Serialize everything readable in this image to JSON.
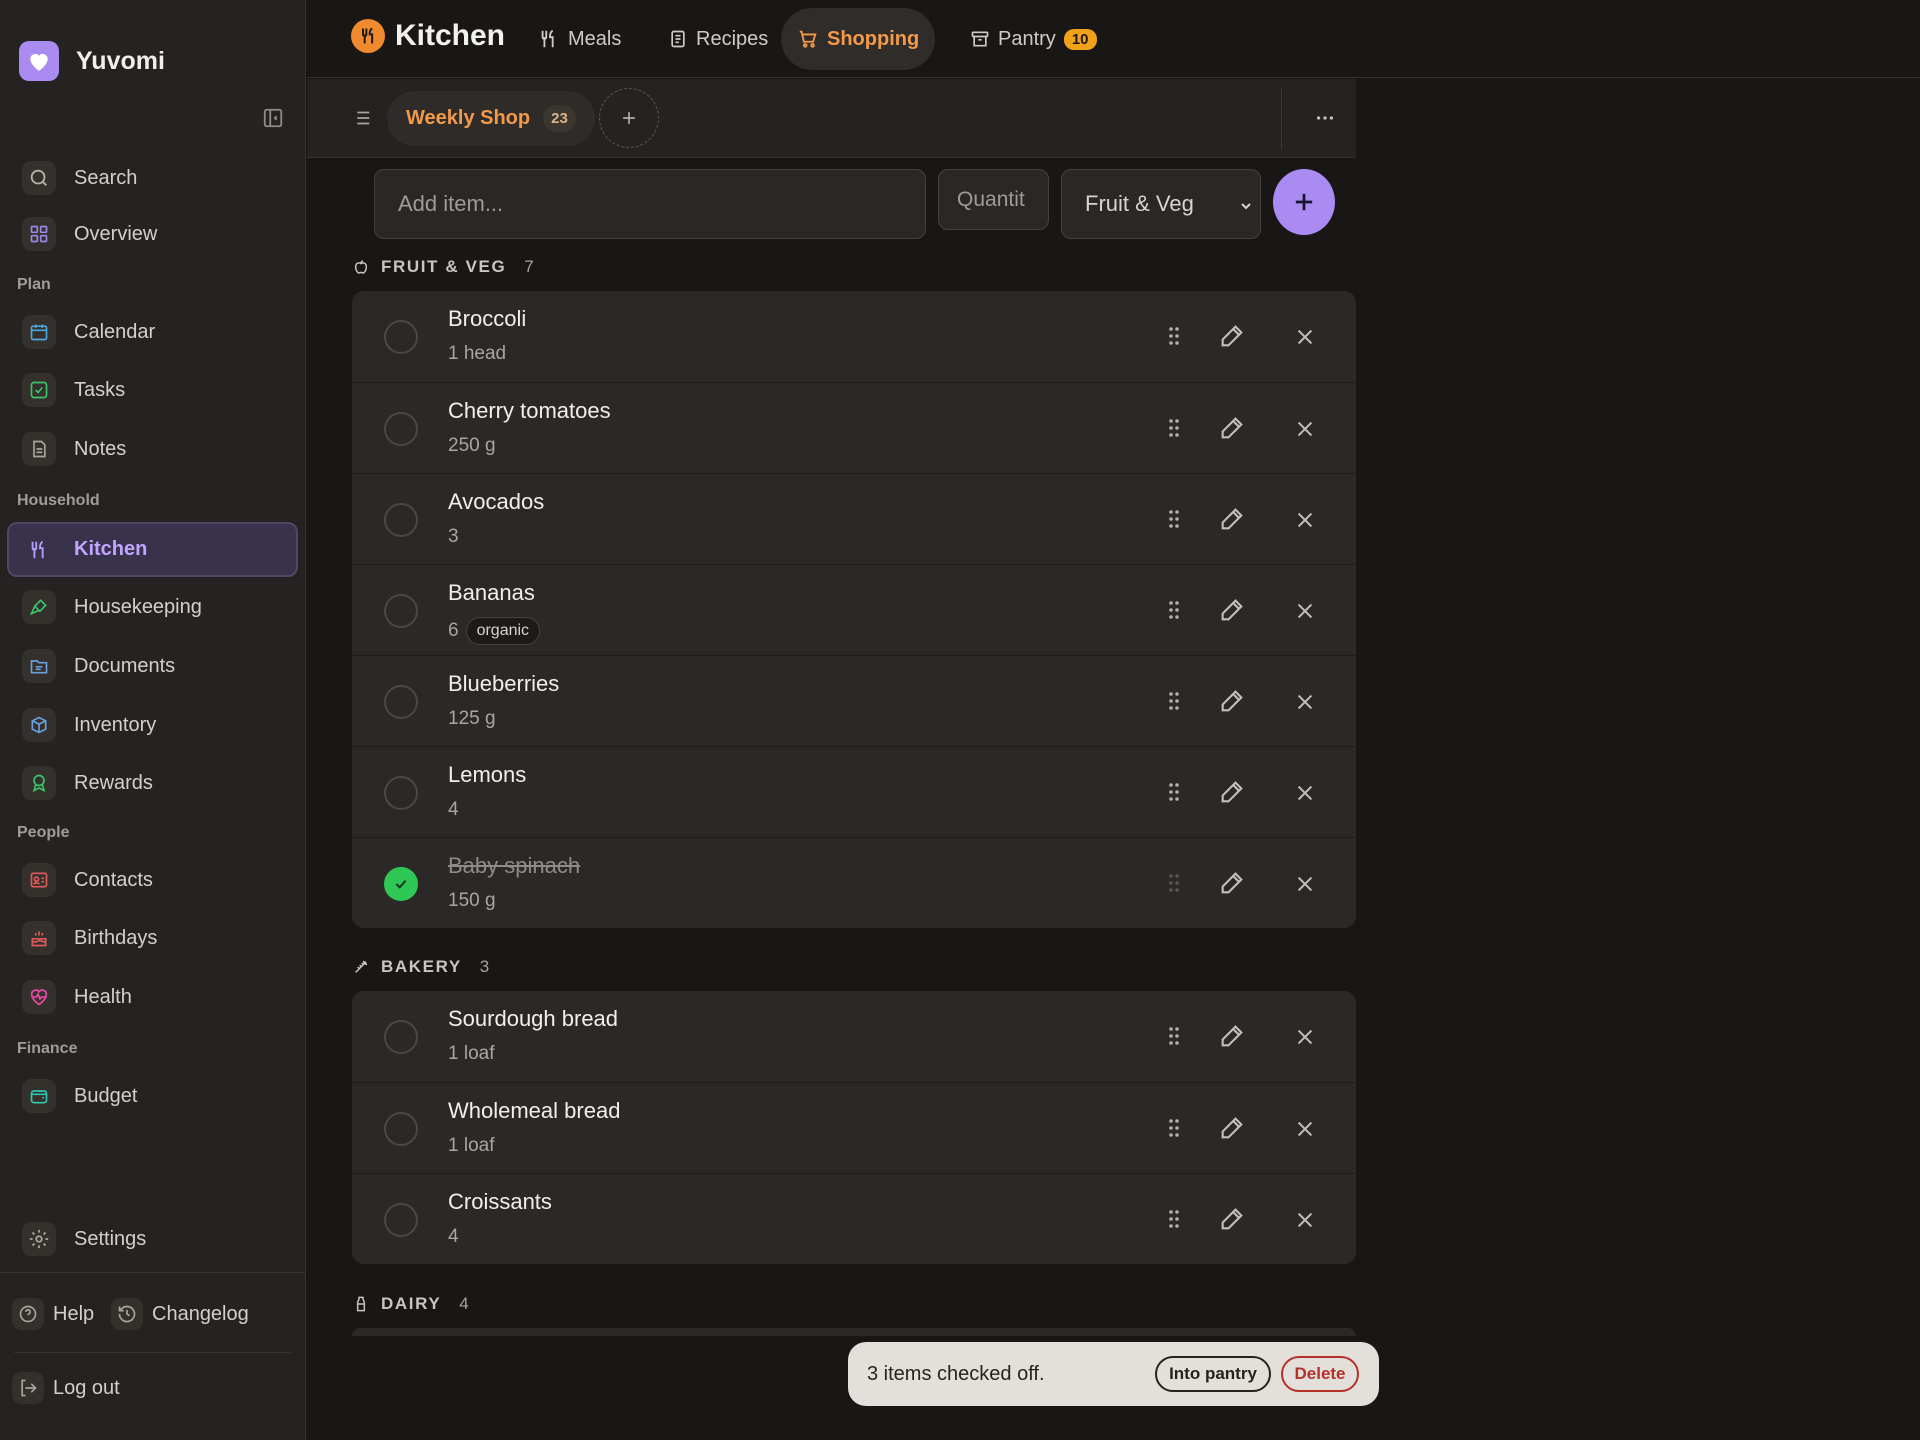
{
  "app": {
    "name": "Yuvomi",
    "accent": "#a98bf2"
  },
  "sidebar": {
    "top_items": [
      {
        "label": "Search",
        "icon": "search-icon"
      },
      {
        "label": "Overview",
        "icon": "grid-icon"
      }
    ],
    "sections": [
      {
        "label": "Plan",
        "items": [
          {
            "label": "Calendar",
            "icon": "calendar-icon"
          },
          {
            "label": "Tasks",
            "icon": "check-square-icon"
          },
          {
            "label": "Notes",
            "icon": "note-icon"
          }
        ]
      },
      {
        "label": "Household",
        "items": [
          {
            "label": "Kitchen",
            "icon": "utensils-icon",
            "active": true
          },
          {
            "label": "Housekeeping",
            "icon": "brush-icon"
          },
          {
            "label": "Documents",
            "icon": "folder-icon"
          },
          {
            "label": "Inventory",
            "icon": "box-icon"
          },
          {
            "label": "Rewards",
            "icon": "award-icon"
          }
        ]
      },
      {
        "label": "People",
        "items": [
          {
            "label": "Contacts",
            "icon": "contact-card-icon"
          },
          {
            "label": "Birthdays",
            "icon": "cake-icon"
          },
          {
            "label": "Health",
            "icon": "heart-pulse-icon"
          }
        ]
      },
      {
        "label": "Finance",
        "items": [
          {
            "label": "Budget",
            "icon": "wallet-icon"
          }
        ]
      }
    ],
    "settings_label": "Settings",
    "help_label": "Help",
    "changelog_label": "Changelog",
    "logout_label": "Log out"
  },
  "topbar": {
    "title": "Kitchen",
    "tabs": [
      {
        "label": "Meals",
        "icon": "utensils-icon"
      },
      {
        "label": "Recipes",
        "icon": "book-icon"
      },
      {
        "label": "Shopping",
        "icon": "cart-icon",
        "active": true
      },
      {
        "label": "Pantry",
        "icon": "archive-icon",
        "badge": "10"
      }
    ]
  },
  "list": {
    "name": "Weekly Shop",
    "count": "23"
  },
  "add_item": {
    "item_placeholder": "Add item...",
    "quantity_placeholder": "Quantit",
    "category": "Fruit & Veg"
  },
  "categories": [
    {
      "name": "FRUIT & VEG",
      "count": "7",
      "icon": "apple-icon",
      "items": [
        {
          "name": "Broccoli",
          "qty": "1 head",
          "checked": false
        },
        {
          "name": "Cherry tomatoes",
          "qty": "250 g",
          "checked": false
        },
        {
          "name": "Avocados",
          "qty": "3",
          "checked": false
        },
        {
          "name": "Bananas",
          "qty": "6",
          "tag": "organic",
          "checked": false
        },
        {
          "name": "Blueberries",
          "qty": "125 g",
          "checked": false
        },
        {
          "name": "Lemons",
          "qty": "4",
          "checked": false
        },
        {
          "name": "Baby spinach",
          "qty": "150 g",
          "checked": true
        }
      ]
    },
    {
      "name": "BAKERY",
      "count": "3",
      "icon": "wheat-icon",
      "items": [
        {
          "name": "Sourdough bread",
          "qty": "1 loaf",
          "checked": false
        },
        {
          "name": "Wholemeal bread",
          "qty": "1 loaf",
          "checked": false
        },
        {
          "name": "Croissants",
          "qty": "4",
          "checked": false
        }
      ]
    },
    {
      "name": "DAIRY",
      "count": "4",
      "icon": "milk-icon",
      "items": []
    }
  ],
  "toast": {
    "message": "3 items checked off.",
    "pantry_label": "Into pantry",
    "delete_label": "Delete"
  }
}
